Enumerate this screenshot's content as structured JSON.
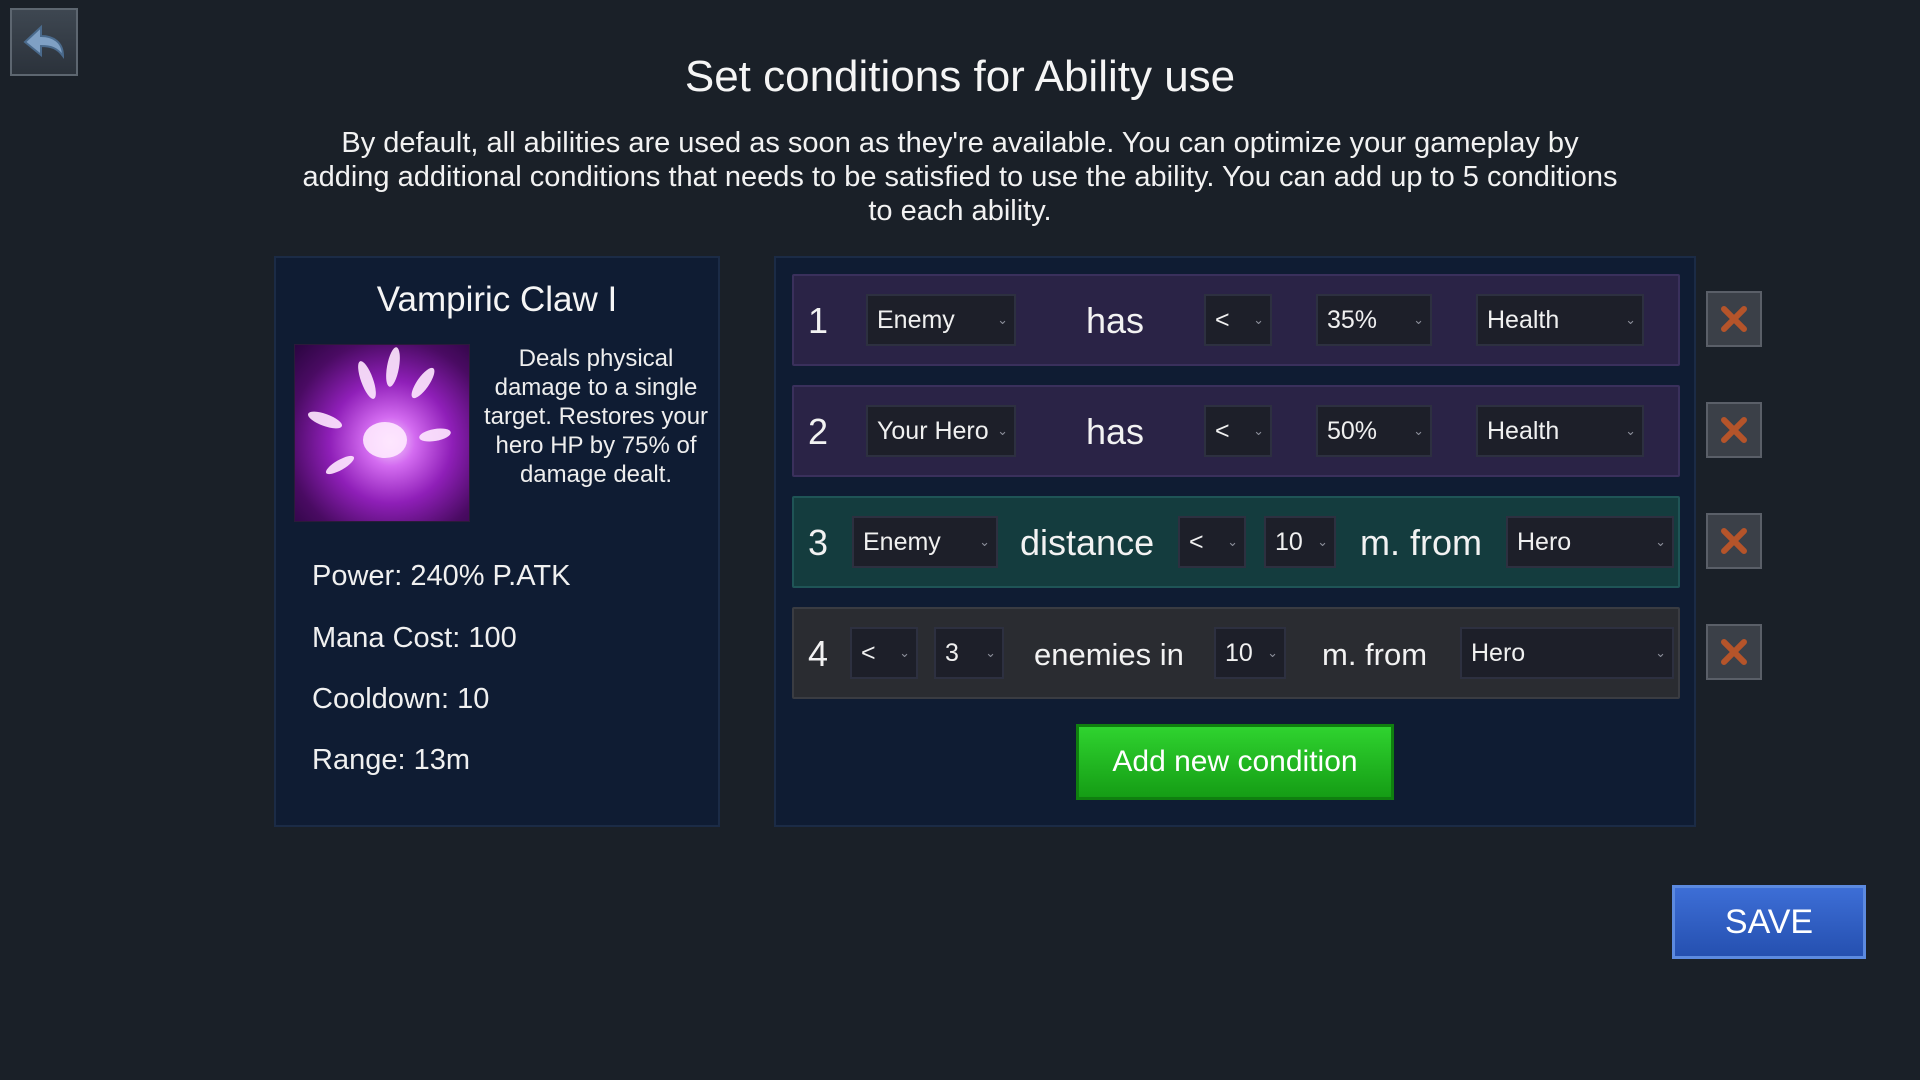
{
  "header": {
    "title": "Set conditions for Ability use",
    "description": "By default, all abilities are used as soon as they're available. You can optimize your gameplay by adding additional conditions that needs to be satisfied to use the ability. You can add up to 5 conditions to each ability."
  },
  "ability": {
    "name": "Vampiric Claw I",
    "description": "Deals physical damage to a single target. Restores your hero HP by 75% of damage dealt.",
    "power": "Power: 240% P.ATK",
    "mana_cost": "Mana Cost: 100",
    "cooldown": "Cooldown: 10",
    "range": "Range: 13m"
  },
  "conditions": [
    {
      "number": "1",
      "subject": "Enemy",
      "verb": "has",
      "operator": "<",
      "value": "35%",
      "stat": "Health"
    },
    {
      "number": "2",
      "subject": "Your Hero",
      "verb": "has",
      "operator": "<",
      "value": "50%",
      "stat": "Health"
    },
    {
      "number": "3",
      "subject": "Enemy",
      "verb": "distance",
      "operator": "<",
      "value": "10",
      "unit": "m. from",
      "target": "Hero"
    },
    {
      "number": "4",
      "operator": "<",
      "count": "3",
      "phrase": "enemies in",
      "value": "10",
      "unit": "m. from",
      "target": "Hero"
    }
  ],
  "buttons": {
    "add_condition": "Add new condition",
    "save": "SAVE"
  },
  "icons": {
    "back": "back-arrow-icon",
    "delete": "close-x-icon",
    "dropdown": "chevron-down-icon"
  },
  "colors": {
    "background": "#1a2028",
    "panel": "#0f1c33",
    "row_purple": "#2a2346",
    "row_teal": "#143c3e",
    "row_gray": "#2a2c31",
    "add_button": "#1fb81f",
    "save_button": "#2f5fc4",
    "delete_x": "#b5542a"
  }
}
